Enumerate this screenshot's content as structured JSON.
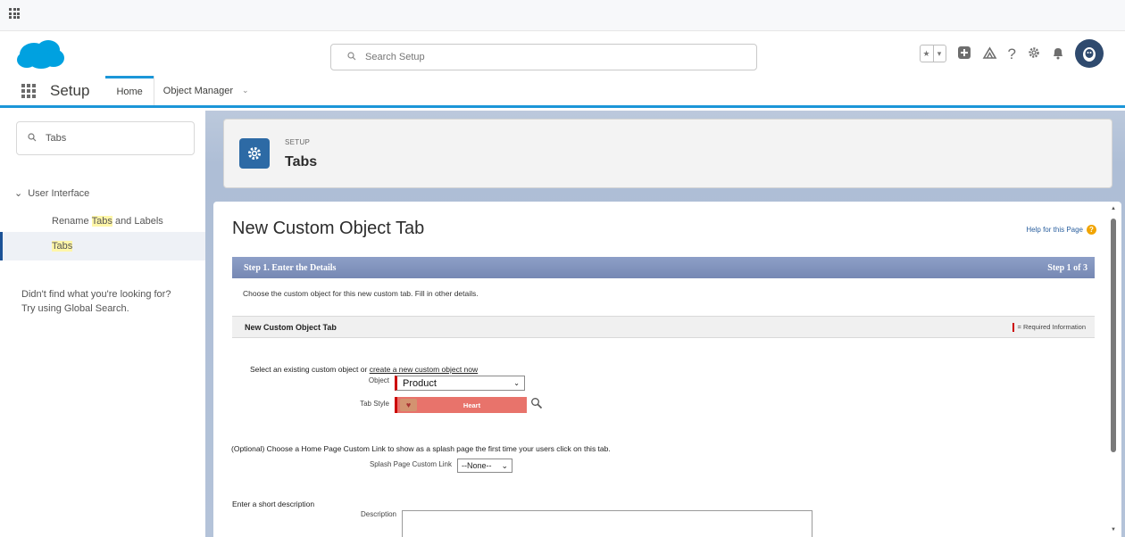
{
  "header": {
    "search_placeholder": "Search Setup",
    "icons": [
      "apps-grid-icon",
      "favorites-star-icon",
      "favorites-dropdown-icon",
      "add-icon",
      "trailhead-icon",
      "help-icon",
      "gear-icon",
      "bell-icon",
      "avatar"
    ]
  },
  "nav": {
    "app_name": "Setup",
    "tabs": [
      {
        "label": "Home"
      },
      {
        "label": "Object Manager"
      }
    ]
  },
  "sidebar": {
    "quickfind_value": "Tabs",
    "group_label": "User Interface",
    "items": [
      {
        "label_before": "Rename ",
        "label_highlight": "Tabs",
        "label_after": " and Labels"
      },
      {
        "label_highlight": "Tabs"
      }
    ],
    "help_text_line1": "Didn't find what you're looking for?",
    "help_text_line2": "Try using Global Search."
  },
  "setup_header": {
    "eyebrow": "SETUP",
    "title": "Tabs"
  },
  "page": {
    "title": "New Custom Object Tab",
    "help_link": "Help for this Page",
    "step_label": "Step 1. Enter the Details",
    "step_count": "Step 1 of 3",
    "step_description": "Choose the custom object for this new custom tab. Fill in other details.",
    "section_title": "New Custom Object Tab",
    "required_info": "= Required Information"
  },
  "form": {
    "select_intro": "Select an existing custom object or",
    "create_link": "create a new custom object now",
    "object_label": "Object",
    "object_value": "Product",
    "tab_style_label": "Tab Style",
    "tab_style_value": "Heart",
    "splash_intro": "(Optional) Choose a Home Page Custom Link to show as a splash page the first time your users click on this tab.",
    "splash_label": "Splash Page Custom Link",
    "splash_value": "--None--",
    "desc_intro": "Enter a short description",
    "desc_label": "Description"
  },
  "colors": {
    "brand_blue": "#1b96d8",
    "step_bar": "#7f91bb",
    "tab_style_bg": "#e8736b",
    "required_red": "#cc0000",
    "setup_icon_bg": "#2d6aa5"
  }
}
